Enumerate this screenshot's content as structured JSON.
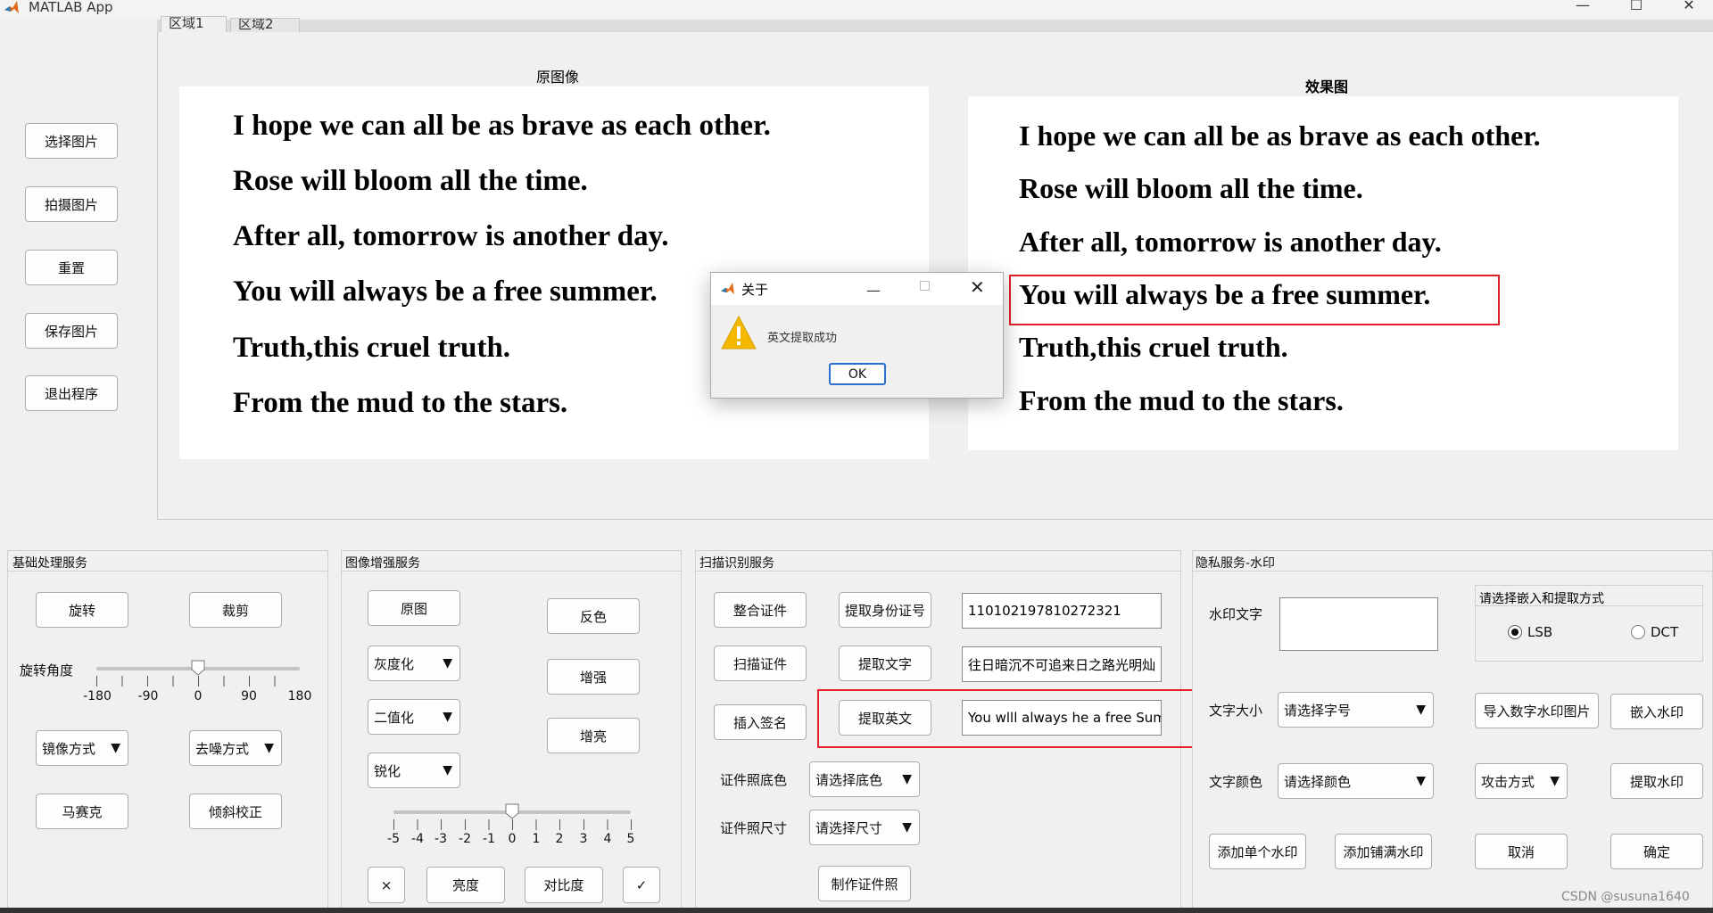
{
  "window": {
    "title": "MATLAB App",
    "controls": [
      "—",
      "☐",
      "✕"
    ]
  },
  "tabs": [
    "区域1",
    "区域2"
  ],
  "sidebar": [
    "选择图片",
    "拍摄图片",
    "重置",
    "保存图片",
    "退出程序"
  ],
  "images": {
    "original_title": "原图像",
    "effect_title": "效果图",
    "lines": [
      "I hope we can all be as brave as each other.",
      "Rose will bloom all the time.",
      "After all, tomorrow is another day.",
      "You will always be a free summer.",
      "Truth,this cruel truth.",
      "From the mud to the stars."
    ]
  },
  "dialog": {
    "title": "关于",
    "message": "英文提取成功",
    "ok": "OK"
  },
  "basic": {
    "title": "基础处理服务",
    "rotate": "旋转",
    "crop": "裁剪",
    "angle_label": "旋转角度",
    "angle_ticks": [
      "-180",
      "-90",
      "0",
      "90",
      "180"
    ],
    "angle_value": 0,
    "mirror": "镜像方式",
    "denoise": "去噪方式",
    "mosaic": "马赛克",
    "tilt": "倾斜校正"
  },
  "enhance": {
    "title": "图像增强服务",
    "original": "原图",
    "invert": "反色",
    "gray": "灰度化",
    "enhance": "增强",
    "binarize": "二值化",
    "brighten": "增亮",
    "sharpen": "锐化",
    "slider_ticks": [
      "-5",
      "-4",
      "-3",
      "-2",
      "-1",
      "0",
      "1",
      "2",
      "3",
      "4",
      "5"
    ],
    "slider_value": 0,
    "close": "×",
    "brightness": "亮度",
    "contrast": "对比度",
    "confirm": "✓"
  },
  "scan": {
    "title": "扫描识别服务",
    "merge": "整合证件",
    "extract_id": "提取身份证号",
    "id_value": "110102197810272321",
    "scan": "扫描证件",
    "extract_text": "提取文字",
    "text_value": "往日暗沉不可追来日之路光明灿",
    "sign": "插入签名",
    "extract_en": "提取英文",
    "en_value": "You wlll always he a free Summ",
    "bg_label": "证件照底色",
    "bg_select": "请选择底色",
    "size_label": "证件照尺寸",
    "size_select": "请选择尺寸",
    "make_photo": "制作证件照"
  },
  "watermark": {
    "title": "隐私服务-水印",
    "text_label": "水印文字",
    "mode_title": "请选择嵌入和提取方式",
    "lsb": "LSB",
    "dct": "DCT",
    "selected_mode": "LSB",
    "size_label": "文字大小",
    "size_select": "请选择字号",
    "import": "导入数字水印图片",
    "embed": "嵌入水印",
    "color_label": "文字颜色",
    "color_select": "请选择颜色",
    "attack": "攻击方式",
    "extract": "提取水印",
    "add_single": "添加单个水印",
    "add_tile": "添加铺满水印",
    "cancel": "取消",
    "ok": "确定"
  },
  "footer": "CSDN @susuna1640",
  "colors": {
    "highlight": "#e0202a",
    "warning": "#f5b800"
  }
}
